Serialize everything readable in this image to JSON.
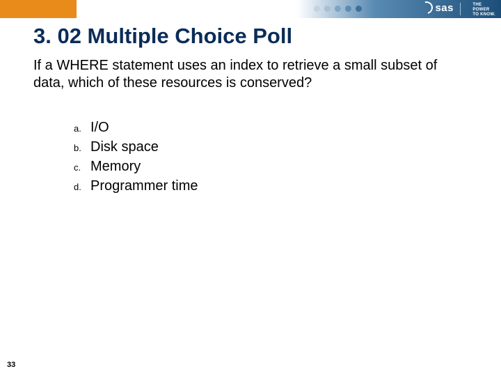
{
  "header": {
    "brand": "sas",
    "tagline_l1": "THE",
    "tagline_l2": "POWER",
    "tagline_l3": "TO KNOW."
  },
  "slide": {
    "title": "3. 02 Multiple Choice Poll",
    "question": "If a WHERE statement uses an index to retrieve a small subset of data, which of these resources is conserved?",
    "options": [
      {
        "label": "a.",
        "text": "I/O"
      },
      {
        "label": "b.",
        "text": "Disk space"
      },
      {
        "label": "c.",
        "text": "Memory"
      },
      {
        "label": "d.",
        "text": "Programmer time"
      }
    ],
    "page_number": "33"
  }
}
